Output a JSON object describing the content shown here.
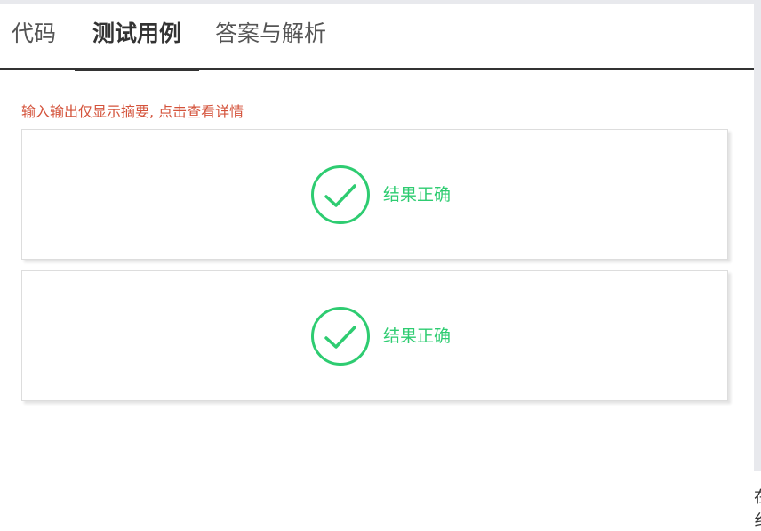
{
  "tabs": [
    {
      "label": "代码",
      "active": false
    },
    {
      "label": "测试用例",
      "active": true
    },
    {
      "label": "答案与解析",
      "active": false
    }
  ],
  "hint": "输入输出仅显示摘要, 点击查看详情",
  "results": [
    {
      "status": "结果正确",
      "icon": "check-circle-icon"
    },
    {
      "status": "结果正确",
      "icon": "check-circle-icon"
    }
  ],
  "edge_text": [
    "在",
    "纟"
  ],
  "colors": {
    "accent": "#2ecc71",
    "hint": "#d4533b",
    "tab_active": "#333333",
    "tab_inactive": "#555555"
  }
}
